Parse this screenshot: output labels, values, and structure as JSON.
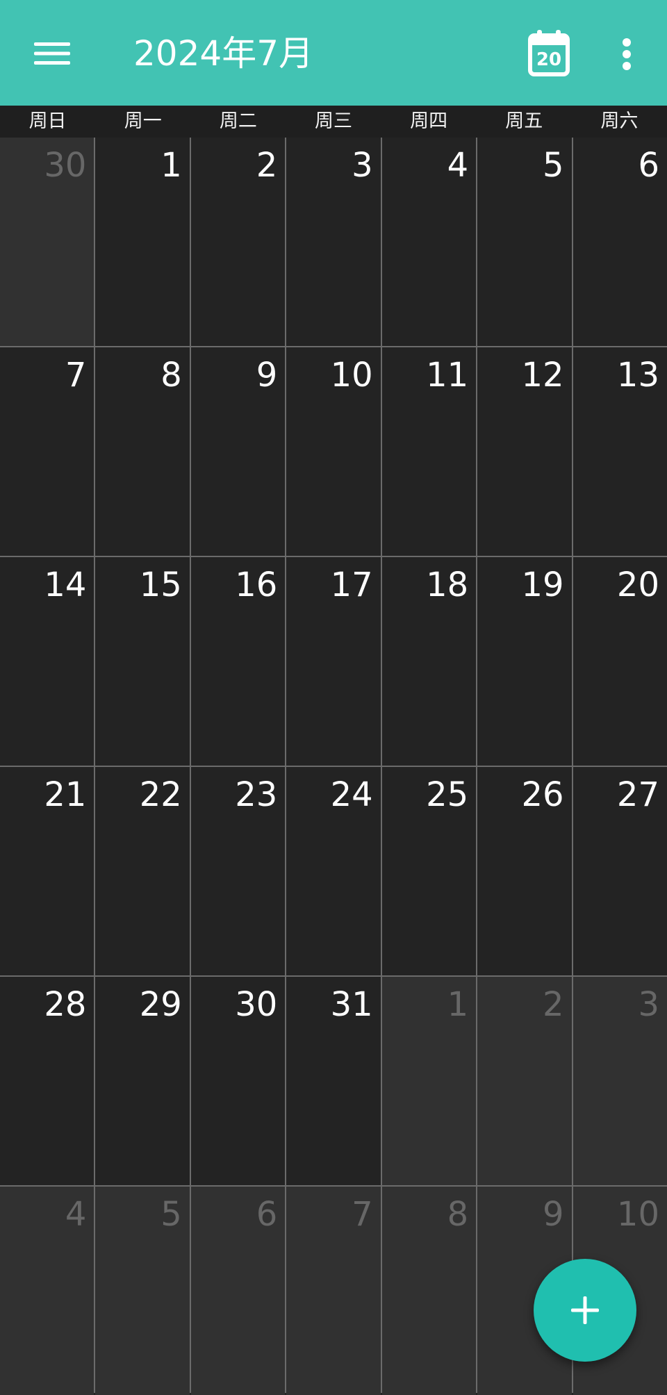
{
  "app_bar": {
    "title": "2024年7月",
    "today_day": "20",
    "background_color": "#42C3B3",
    "icons": [
      "menu-icon",
      "calendar-today-icon",
      "more-vert-icon"
    ]
  },
  "weekdays": [
    "周日",
    "周一",
    "周二",
    "周三",
    "周四",
    "周五",
    "周六"
  ],
  "weeks": [
    [
      {
        "day": "30",
        "other": true
      },
      {
        "day": "1",
        "other": false
      },
      {
        "day": "2",
        "other": false
      },
      {
        "day": "3",
        "other": false
      },
      {
        "day": "4",
        "other": false
      },
      {
        "day": "5",
        "other": false
      },
      {
        "day": "6",
        "other": false
      }
    ],
    [
      {
        "day": "7",
        "other": false
      },
      {
        "day": "8",
        "other": false
      },
      {
        "day": "9",
        "other": false
      },
      {
        "day": "10",
        "other": false
      },
      {
        "day": "11",
        "other": false
      },
      {
        "day": "12",
        "other": false
      },
      {
        "day": "13",
        "other": false
      }
    ],
    [
      {
        "day": "14",
        "other": false
      },
      {
        "day": "15",
        "other": false
      },
      {
        "day": "16",
        "other": false
      },
      {
        "day": "17",
        "other": false
      },
      {
        "day": "18",
        "other": false
      },
      {
        "day": "19",
        "other": false
      },
      {
        "day": "20",
        "other": false
      }
    ],
    [
      {
        "day": "21",
        "other": false
      },
      {
        "day": "22",
        "other": false
      },
      {
        "day": "23",
        "other": false
      },
      {
        "day": "24",
        "other": false
      },
      {
        "day": "25",
        "other": false
      },
      {
        "day": "26",
        "other": false
      },
      {
        "day": "27",
        "other": false
      }
    ],
    [
      {
        "day": "28",
        "other": false
      },
      {
        "day": "29",
        "other": false
      },
      {
        "day": "30",
        "other": false
      },
      {
        "day": "31",
        "other": false
      },
      {
        "day": "1",
        "other": true
      },
      {
        "day": "2",
        "other": true
      },
      {
        "day": "3",
        "other": true
      }
    ],
    [
      {
        "day": "4",
        "other": true
      },
      {
        "day": "5",
        "other": true
      },
      {
        "day": "6",
        "other": true
      },
      {
        "day": "7",
        "other": true
      },
      {
        "day": "8",
        "other": true
      },
      {
        "day": "9",
        "other": true
      },
      {
        "day": "10",
        "other": true
      }
    ]
  ],
  "fab": {
    "icon": "plus-icon",
    "color": "#20BFAF"
  }
}
